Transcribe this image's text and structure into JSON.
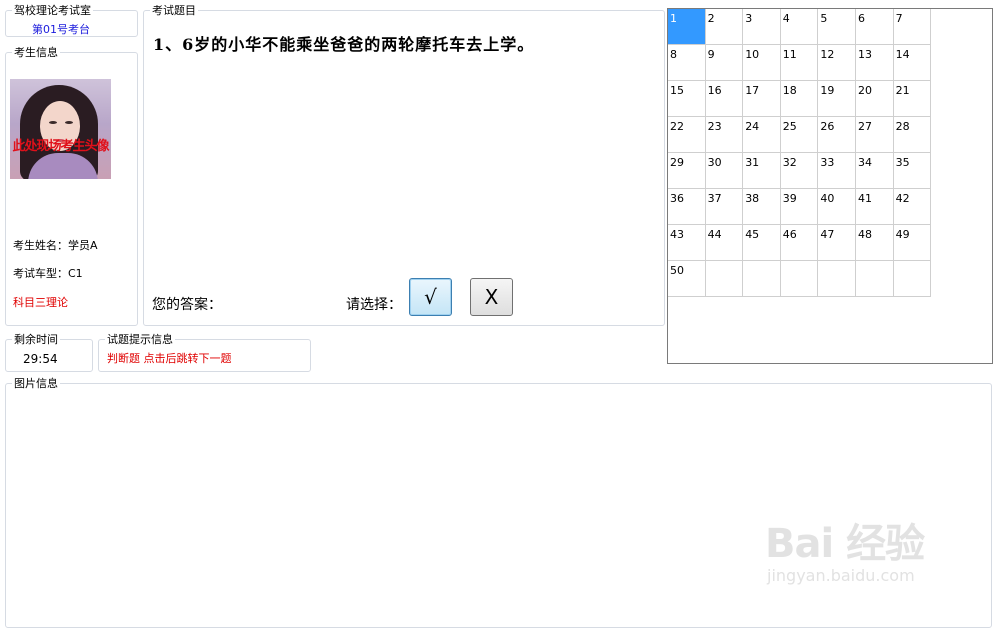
{
  "room": {
    "legend": "驾校理论考试室",
    "station": "第01号考台"
  },
  "candidate": {
    "legend": "考生信息",
    "avatar_caption": "此处现场考生头像",
    "name_line": "考生姓名：学员A",
    "vehicle_line": "考试车型：C1",
    "subject": "科目三理论"
  },
  "exam": {
    "legend": "考试题目",
    "question": "1、6岁的小华不能乘坐爸爸的两轮摩托车去上学。",
    "answer_label": "您的答案：",
    "choose_label": "请选择：",
    "true_button": "√",
    "false_button": "X"
  },
  "timer": {
    "legend": "剩余时间",
    "value": "29:54"
  },
  "hint": {
    "legend": "试题提示信息",
    "text": "判断题 点击后跳转下一题"
  },
  "picture": {
    "legend": "图片信息"
  },
  "question_grid": {
    "numbers": [
      "1",
      "2",
      "3",
      "4",
      "5",
      "6",
      "7",
      "8",
      "9",
      "10",
      "11",
      "12",
      "13",
      "14",
      "15",
      "16",
      "17",
      "18",
      "19",
      "20",
      "21",
      "22",
      "23",
      "24",
      "25",
      "26",
      "27",
      "28",
      "29",
      "30",
      "31",
      "32",
      "33",
      "34",
      "35",
      "36",
      "37",
      "38",
      "39",
      "40",
      "41",
      "42",
      "43",
      "44",
      "45",
      "46",
      "47",
      "48",
      "49",
      "50"
    ],
    "selected": "1",
    "selected_color": "#3399ff"
  },
  "watermark": {
    "main": "Bai 经验",
    "sub": "jingyan.baidu.com"
  },
  "colors": {
    "blue_text": "#1a1adc",
    "red_text": "#e00000",
    "border": "#d6dbe3"
  }
}
